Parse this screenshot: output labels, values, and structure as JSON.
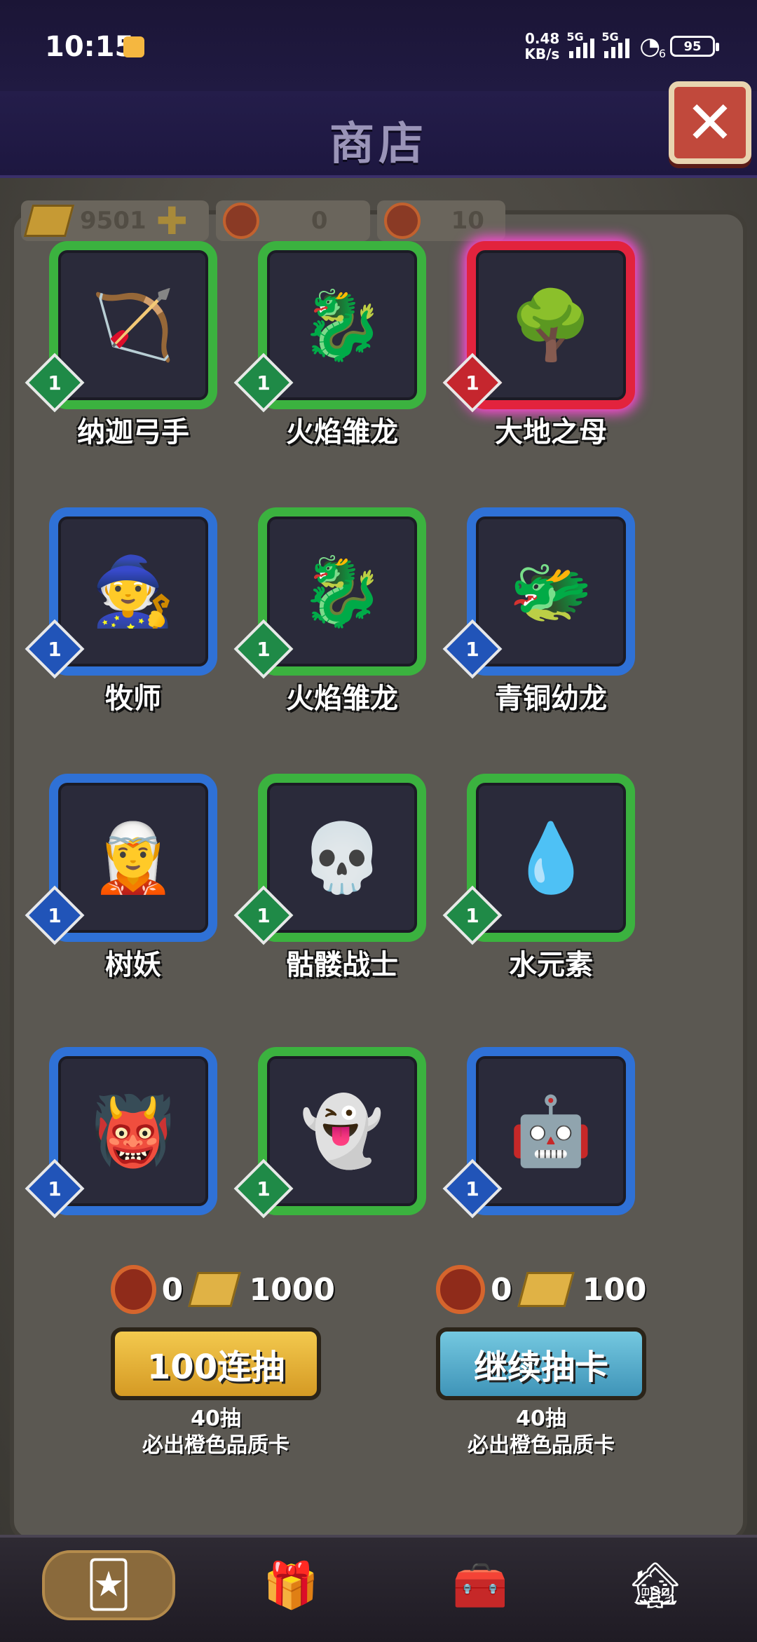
{
  "status_bar": {
    "time": "10:15",
    "net_speed_value": "0.48",
    "net_speed_unit": "KB/s",
    "sim1": "5G",
    "sim2": "5G",
    "wifi_badge": "6",
    "battery": "95"
  },
  "header": {
    "title": "商店",
    "close_label": "✕"
  },
  "resources": {
    "gold": "9501",
    "tokens": "0",
    "tickets": "10"
  },
  "cards": [
    {
      "name": "纳迦弓手",
      "level": "1",
      "rarity": "green",
      "icon": "🏹"
    },
    {
      "name": "火焰雏龙",
      "level": "1",
      "rarity": "green",
      "icon": "🐉"
    },
    {
      "name": "大地之母",
      "level": "1",
      "rarity": "red",
      "icon": "🌳"
    },
    {
      "name": "牧师",
      "level": "1",
      "rarity": "blue",
      "icon": "🧙"
    },
    {
      "name": "火焰雏龙",
      "level": "1",
      "rarity": "green",
      "icon": "🐉"
    },
    {
      "name": "青铜幼龙",
      "level": "1",
      "rarity": "blue",
      "icon": "🐲"
    },
    {
      "name": "树妖",
      "level": "1",
      "rarity": "blue",
      "icon": "🧝"
    },
    {
      "name": "骷髅战士",
      "level": "1",
      "rarity": "green",
      "icon": "💀"
    },
    {
      "name": "水元素",
      "level": "1",
      "rarity": "green",
      "icon": "💧"
    },
    {
      "name": "",
      "level": "1",
      "rarity": "blue",
      "icon": "👹"
    },
    {
      "name": "",
      "level": "1",
      "rarity": "green",
      "icon": "👻"
    },
    {
      "name": "",
      "level": "1",
      "rarity": "blue",
      "icon": "🤖"
    }
  ],
  "draw_left": {
    "token_cost": "0",
    "gold_cost": "1000",
    "button_label": "100连抽",
    "note_line1": "40抽",
    "note_line2": "必出橙色品质卡"
  },
  "draw_right": {
    "token_cost": "0",
    "gold_cost": "100",
    "button_label": "继续抽卡",
    "note_line1": "40抽",
    "note_line2": "必出橙色品质卡"
  },
  "bottom_nav": [
    {
      "icon": "card-icon",
      "glyph": "🃏"
    },
    {
      "icon": "gift-icon",
      "glyph": "🎁"
    },
    {
      "icon": "chest-icon",
      "glyph": "🧰"
    },
    {
      "icon": "house-icon",
      "glyph": "🏚"
    }
  ]
}
